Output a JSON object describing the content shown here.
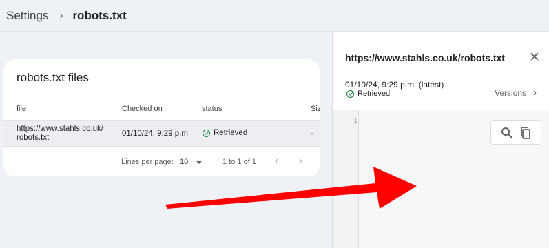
{
  "breadcrumb": {
    "root": "Settings",
    "separator": "›",
    "current": "robots.txt"
  },
  "card": {
    "title": "robots.txt files",
    "columns": [
      "file",
      "Checked on",
      "status",
      "Siz"
    ],
    "rows": [
      {
        "file": "https://www.stahls.co.uk/robots.txt",
        "checked_on": "01/10/24, 9:29 p.m",
        "status": "Retrieved",
        "size": "-"
      }
    ],
    "pagination": {
      "lines_label": "Lines per page:",
      "lines_value": "10",
      "range": "1 to 1 of 1",
      "prev": "‹",
      "next": "›"
    }
  },
  "panel": {
    "title": "https://www.stahls.co.uk/robots.txt",
    "close": "✕",
    "date": "01/10/24, 9:29 p.m. (latest)",
    "status": "Retrieved",
    "versions_label": "Versions",
    "versions_chevron": "›",
    "line_number": "1"
  },
  "icons": {
    "check": "check-circle-icon",
    "search": "search-icon",
    "copy": "copy-icon",
    "close": "close-icon",
    "caret": "caret-down-icon"
  },
  "colors": {
    "success": "#188038",
    "arrow": "#ff0000",
    "background": "#eef1f6"
  }
}
